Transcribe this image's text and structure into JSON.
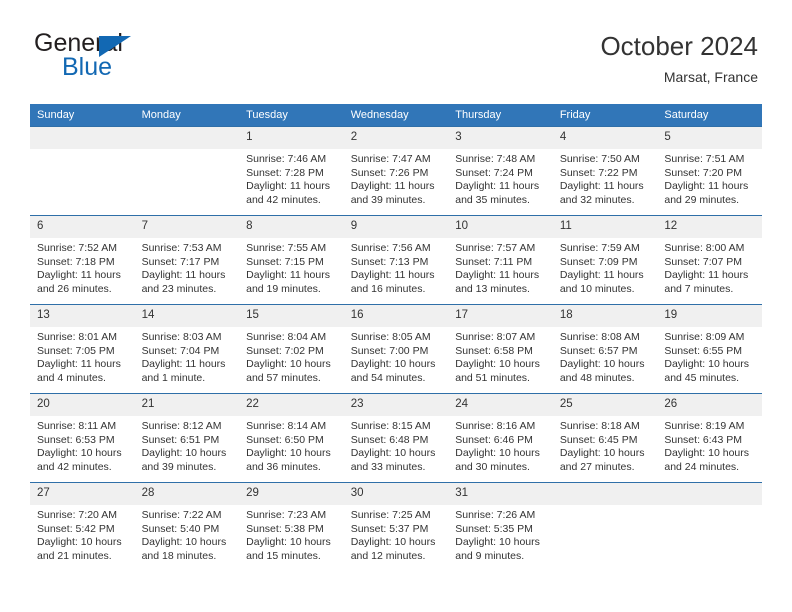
{
  "logo": {
    "part1": "General",
    "part2": "Blue",
    "triangle_color": "#1268b3",
    "text_color": "#231f20"
  },
  "header": {
    "title": "October 2024",
    "subtitle": "Marsat, France"
  },
  "theme": {
    "header_blue": "#3176b8",
    "row_border_blue": "#2f6fa8",
    "daynum_band": "#f0f0f0"
  },
  "calendar": {
    "weekday_headers": [
      "Sunday",
      "Monday",
      "Tuesday",
      "Wednesday",
      "Thursday",
      "Friday",
      "Saturday"
    ],
    "labels": {
      "sunrise": "Sunrise:",
      "sunset": "Sunset:",
      "daylight": "Daylight:"
    },
    "weeks": [
      [
        {
          "day": "",
          "empty": true
        },
        {
          "day": "",
          "empty": true
        },
        {
          "day": "1",
          "sunrise": "Sunrise: 7:46 AM",
          "sunset": "Sunset: 7:28 PM",
          "daylight": "Daylight: 11 hours and 42 minutes."
        },
        {
          "day": "2",
          "sunrise": "Sunrise: 7:47 AM",
          "sunset": "Sunset: 7:26 PM",
          "daylight": "Daylight: 11 hours and 39 minutes."
        },
        {
          "day": "3",
          "sunrise": "Sunrise: 7:48 AM",
          "sunset": "Sunset: 7:24 PM",
          "daylight": "Daylight: 11 hours and 35 minutes."
        },
        {
          "day": "4",
          "sunrise": "Sunrise: 7:50 AM",
          "sunset": "Sunset: 7:22 PM",
          "daylight": "Daylight: 11 hours and 32 minutes."
        },
        {
          "day": "5",
          "sunrise": "Sunrise: 7:51 AM",
          "sunset": "Sunset: 7:20 PM",
          "daylight": "Daylight: 11 hours and 29 minutes."
        }
      ],
      [
        {
          "day": "6",
          "sunrise": "Sunrise: 7:52 AM",
          "sunset": "Sunset: 7:18 PM",
          "daylight": "Daylight: 11 hours and 26 minutes."
        },
        {
          "day": "7",
          "sunrise": "Sunrise: 7:53 AM",
          "sunset": "Sunset: 7:17 PM",
          "daylight": "Daylight: 11 hours and 23 minutes."
        },
        {
          "day": "8",
          "sunrise": "Sunrise: 7:55 AM",
          "sunset": "Sunset: 7:15 PM",
          "daylight": "Daylight: 11 hours and 19 minutes."
        },
        {
          "day": "9",
          "sunrise": "Sunrise: 7:56 AM",
          "sunset": "Sunset: 7:13 PM",
          "daylight": "Daylight: 11 hours and 16 minutes."
        },
        {
          "day": "10",
          "sunrise": "Sunrise: 7:57 AM",
          "sunset": "Sunset: 7:11 PM",
          "daylight": "Daylight: 11 hours and 13 minutes."
        },
        {
          "day": "11",
          "sunrise": "Sunrise: 7:59 AM",
          "sunset": "Sunset: 7:09 PM",
          "daylight": "Daylight: 11 hours and 10 minutes."
        },
        {
          "day": "12",
          "sunrise": "Sunrise: 8:00 AM",
          "sunset": "Sunset: 7:07 PM",
          "daylight": "Daylight: 11 hours and 7 minutes."
        }
      ],
      [
        {
          "day": "13",
          "sunrise": "Sunrise: 8:01 AM",
          "sunset": "Sunset: 7:05 PM",
          "daylight": "Daylight: 11 hours and 4 minutes."
        },
        {
          "day": "14",
          "sunrise": "Sunrise: 8:03 AM",
          "sunset": "Sunset: 7:04 PM",
          "daylight": "Daylight: 11 hours and 1 minute."
        },
        {
          "day": "15",
          "sunrise": "Sunrise: 8:04 AM",
          "sunset": "Sunset: 7:02 PM",
          "daylight": "Daylight: 10 hours and 57 minutes."
        },
        {
          "day": "16",
          "sunrise": "Sunrise: 8:05 AM",
          "sunset": "Sunset: 7:00 PM",
          "daylight": "Daylight: 10 hours and 54 minutes."
        },
        {
          "day": "17",
          "sunrise": "Sunrise: 8:07 AM",
          "sunset": "Sunset: 6:58 PM",
          "daylight": "Daylight: 10 hours and 51 minutes."
        },
        {
          "day": "18",
          "sunrise": "Sunrise: 8:08 AM",
          "sunset": "Sunset: 6:57 PM",
          "daylight": "Daylight: 10 hours and 48 minutes."
        },
        {
          "day": "19",
          "sunrise": "Sunrise: 8:09 AM",
          "sunset": "Sunset: 6:55 PM",
          "daylight": "Daylight: 10 hours and 45 minutes."
        }
      ],
      [
        {
          "day": "20",
          "sunrise": "Sunrise: 8:11 AM",
          "sunset": "Sunset: 6:53 PM",
          "daylight": "Daylight: 10 hours and 42 minutes."
        },
        {
          "day": "21",
          "sunrise": "Sunrise: 8:12 AM",
          "sunset": "Sunset: 6:51 PM",
          "daylight": "Daylight: 10 hours and 39 minutes."
        },
        {
          "day": "22",
          "sunrise": "Sunrise: 8:14 AM",
          "sunset": "Sunset: 6:50 PM",
          "daylight": "Daylight: 10 hours and 36 minutes."
        },
        {
          "day": "23",
          "sunrise": "Sunrise: 8:15 AM",
          "sunset": "Sunset: 6:48 PM",
          "daylight": "Daylight: 10 hours and 33 minutes."
        },
        {
          "day": "24",
          "sunrise": "Sunrise: 8:16 AM",
          "sunset": "Sunset: 6:46 PM",
          "daylight": "Daylight: 10 hours and 30 minutes."
        },
        {
          "day": "25",
          "sunrise": "Sunrise: 8:18 AM",
          "sunset": "Sunset: 6:45 PM",
          "daylight": "Daylight: 10 hours and 27 minutes."
        },
        {
          "day": "26",
          "sunrise": "Sunrise: 8:19 AM",
          "sunset": "Sunset: 6:43 PM",
          "daylight": "Daylight: 10 hours and 24 minutes."
        }
      ],
      [
        {
          "day": "27",
          "sunrise": "Sunrise: 7:20 AM",
          "sunset": "Sunset: 5:42 PM",
          "daylight": "Daylight: 10 hours and 21 minutes."
        },
        {
          "day": "28",
          "sunrise": "Sunrise: 7:22 AM",
          "sunset": "Sunset: 5:40 PM",
          "daylight": "Daylight: 10 hours and 18 minutes."
        },
        {
          "day": "29",
          "sunrise": "Sunrise: 7:23 AM",
          "sunset": "Sunset: 5:38 PM",
          "daylight": "Daylight: 10 hours and 15 minutes."
        },
        {
          "day": "30",
          "sunrise": "Sunrise: 7:25 AM",
          "sunset": "Sunset: 5:37 PM",
          "daylight": "Daylight: 10 hours and 12 minutes."
        },
        {
          "day": "31",
          "sunrise": "Sunrise: 7:26 AM",
          "sunset": "Sunset: 5:35 PM",
          "daylight": "Daylight: 10 hours and 9 minutes."
        },
        {
          "day": "",
          "empty": true
        },
        {
          "day": "",
          "empty": true
        }
      ]
    ]
  }
}
